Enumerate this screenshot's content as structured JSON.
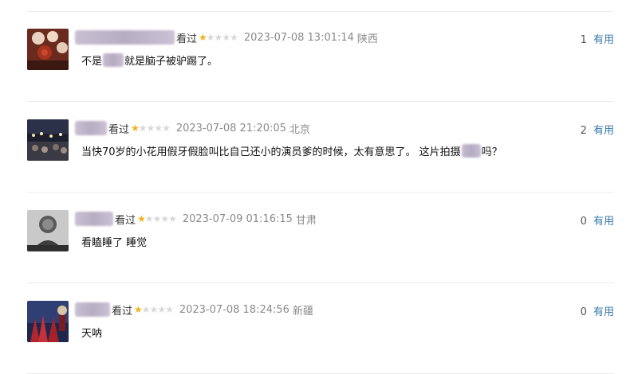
{
  "reviews": [
    {
      "status": "看过",
      "rating": 1,
      "max_rating": 5,
      "time": "2023-07-08 13:01:14",
      "location": "陕西",
      "useful_count": "1",
      "useful_label": "有用",
      "content_parts": [
        "不是",
        "就是脑子被驴踢了。"
      ]
    },
    {
      "status": "看过",
      "rating": 1,
      "max_rating": 5,
      "time": "2023-07-08 21:20:05",
      "location": "北京",
      "useful_count": "2",
      "useful_label": "有用",
      "content_parts": [
        "当快70岁的小花用假牙假脸叫比自己还小的演员爹的时候，太有意思了。 这片拍摄",
        "吗？"
      ]
    },
    {
      "status": "看过",
      "rating": 1,
      "max_rating": 5,
      "time": "2023-07-09 01:16:15",
      "location": "甘肃",
      "useful_count": "0",
      "useful_label": "有用",
      "content_parts": [
        "看瞌睡了 睡觉"
      ]
    },
    {
      "status": "看过",
      "rating": 1,
      "max_rating": 5,
      "time": "2023-07-08 18:24:56",
      "location": "新疆",
      "useful_count": "0",
      "useful_label": "有用",
      "content_parts": [
        "天呐"
      ]
    }
  ],
  "colors": {
    "star_on": "#f2b019",
    "star_off": "#d8d8d8",
    "link": "#3377aa",
    "meta_text": "#8a8a8a"
  },
  "icons": {
    "star_filled": "star-filled-icon",
    "star_empty": "star-empty-icon"
  }
}
